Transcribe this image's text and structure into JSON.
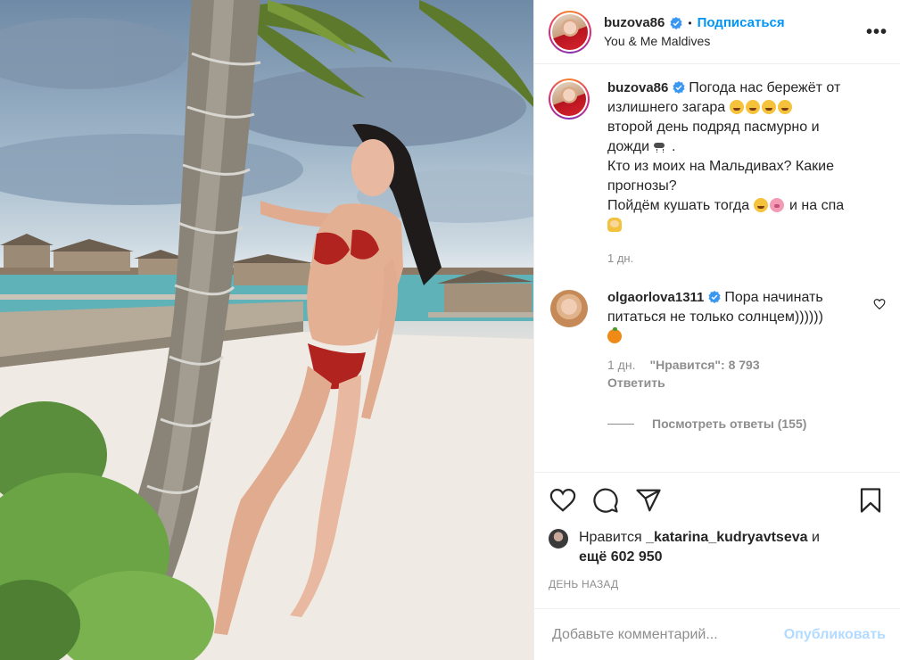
{
  "header": {
    "username": "buzova86",
    "dot": "•",
    "follow_label": "Подписаться",
    "location": "You & Me Maldives",
    "more_glyph": "•••"
  },
  "caption": {
    "username": "buzova86",
    "lines": [
      "Погода нас бережёт от",
      "излишнего загара",
      "второй день подряд пасмурно и",
      "дожди",
      "Кто из моих на Мальдивах? Какие",
      "прогнозы?",
      "Пойдём кушать тогда",
      "и на спа"
    ],
    "line_end_dot": ".",
    "time": "1 дн."
  },
  "comment": {
    "username": "olgaorlova1311",
    "text_line1": "Пора начинать",
    "text_line2": "питаться не только солнцем))))))",
    "time": "1 дн.",
    "likes": "\"Нравится\": 8 793",
    "reply_label": "Ответить",
    "view_replies_label": "Посмотреть ответы (155)"
  },
  "likes": {
    "prefix": "Нравится",
    "user": "_katarina_kudryavtseva",
    "and": "и",
    "more": "ещё 602 950"
  },
  "date": "ДЕНЬ НАЗАД",
  "add_comment": {
    "placeholder": "Добавьте комментарий...",
    "post_label": "Опубликовать"
  },
  "colors": {
    "link_blue": "#0095f6",
    "post_disabled": "#b3dbff",
    "muted": "#8e8e8e",
    "text": "#262626"
  }
}
